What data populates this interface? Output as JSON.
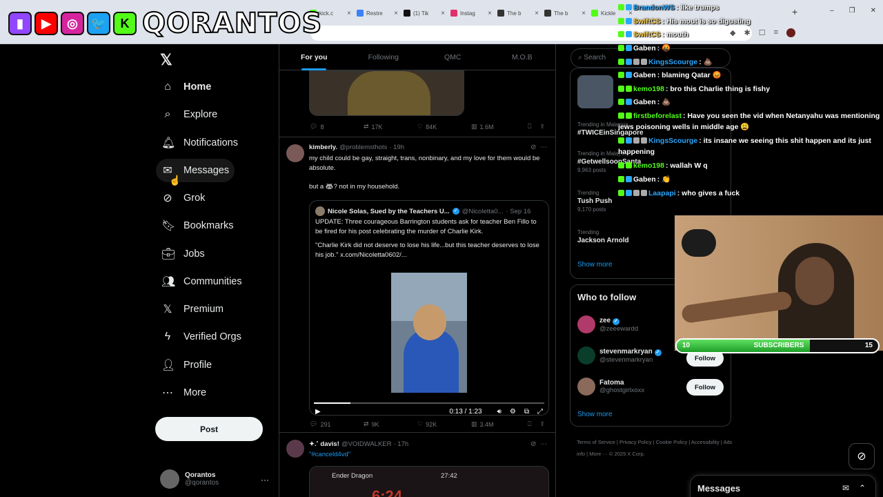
{
  "browser": {
    "tabs": [
      {
        "label": "kick.c",
        "color": "#53fc18"
      },
      {
        "label": "Restre",
        "color": "#3b82f6"
      },
      {
        "label": "(1) Tik",
        "color": "#111111"
      },
      {
        "label": "Instag",
        "color": "#e1306c"
      },
      {
        "label": "The b",
        "color": "#333333"
      },
      {
        "label": "The b",
        "color": "#333333"
      },
      {
        "label": "Kickle",
        "color": "#53fc18"
      }
    ],
    "newtab": "+",
    "window_controls": [
      "–",
      "❐",
      "✕"
    ]
  },
  "stream_logo": {
    "brand": "QORANTOS",
    "platforms": [
      {
        "name": "twitch-icon",
        "glyph": "▮",
        "color": "#9146ff"
      },
      {
        "name": "youtube-icon",
        "glyph": "▶",
        "color": "#ff0000"
      },
      {
        "name": "instagram-icon",
        "glyph": "◎",
        "color": "#d6249f"
      },
      {
        "name": "twitter-icon",
        "glyph": "🐦",
        "color": "#1da1f2"
      },
      {
        "name": "kick-icon",
        "glyph": "K",
        "color": "#53fc18"
      }
    ]
  },
  "nav": {
    "logo": "𝕏",
    "items": [
      {
        "name": "home",
        "label": "Home",
        "icon": "⌂"
      },
      {
        "name": "explore",
        "label": "Explore",
        "icon": "⌕"
      },
      {
        "name": "notifications",
        "label": "Notifications",
        "icon": "🔔︎"
      },
      {
        "name": "messages",
        "label": "Messages",
        "icon": "✉"
      },
      {
        "name": "grok",
        "label": "Grok",
        "icon": "⊘"
      },
      {
        "name": "bookmarks",
        "label": "Bookmarks",
        "icon": "🔖︎"
      },
      {
        "name": "jobs",
        "label": "Jobs",
        "icon": "💼︎"
      },
      {
        "name": "communities",
        "label": "Communities",
        "icon": "👥︎"
      },
      {
        "name": "premium",
        "label": "Premium",
        "icon": "𝕏"
      },
      {
        "name": "verified-orgs",
        "label": "Verified Orgs",
        "icon": "ϟ"
      },
      {
        "name": "profile",
        "label": "Profile",
        "icon": "👤︎"
      },
      {
        "name": "more",
        "label": "More",
        "icon": "⋯"
      }
    ],
    "post_label": "Post",
    "account": {
      "name": "Qorantos",
      "handle": "@qorantos",
      "more": "···"
    }
  },
  "feed": {
    "tabs": [
      "For you",
      "Following",
      "QMC",
      "M.O.B"
    ],
    "tweet1_actions": {
      "replies": "8",
      "reposts": "17K",
      "likes": "84K",
      "views": "1.6M"
    },
    "tweet2": {
      "name": "kimberly.",
      "handle": "@problemsthots",
      "time": "· 19h",
      "text1": "my child could be gay, straight, trans, nonbinary, and my love for them would be absolute.",
      "text2": "but a 🦝? not in my household.",
      "quote": {
        "name": "Nicole Solas, Sued by the Teachers U...",
        "handle": "@Nicoletta0...",
        "time": "· Sep 16",
        "text1": "UPDATE: Three courageous Barrington students ask for teacher Ben Fillo to be fired for his post celebrating the murder of Charlie Kirk.",
        "text2": "\"Charlie Kirk did not deserve to lose his life...but this teacher deserves to lose his job.\" x.com/Nicoletta0602/...",
        "video_time": "0:13 / 1:23",
        "video_progress": 0.16
      },
      "actions": {
        "replies": "291",
        "reposts": "9K",
        "likes": "92K",
        "views": "3.4M"
      }
    },
    "tweet3": {
      "name": "✦.˚ davis! ",
      "handle": "@VOIDWALKER",
      "time": "· 17h",
      "text": "\"#canceld4vd\"",
      "media_title": "Ender Dragon",
      "media_time": "27:42",
      "media_big": "6:24"
    }
  },
  "right": {
    "search_placeholder": "Search",
    "trends": [
      {
        "meta": "Trending in Malaysia",
        "title": "#TWICEinSingapore",
        "posts": ""
      },
      {
        "meta": "Trending in Malaysia",
        "title": "#GetwellsoonSanta",
        "posts": "9,963 posts"
      },
      {
        "meta": "Trending",
        "title": "Tush Push",
        "posts": "9,170 posts"
      },
      {
        "meta": "Trending",
        "title": "Jackson Arnold",
        "posts": ""
      }
    ],
    "show_more": "Show more",
    "who_to_follow": {
      "title": "Who to follow",
      "users": [
        {
          "name": "zee",
          "handle": "@zeeewardd",
          "color": "#b03a6a"
        },
        {
          "name": "stevenmarkryan",
          "handle": "@stevenmarkryan",
          "color": "#0a3d2a"
        },
        {
          "name": "Fatoma",
          "handle": "@ghostgirlxoxx",
          "color": "#8a6a5a"
        }
      ],
      "follow_label": "Follow",
      "show_more": "Show more"
    },
    "footer": "Terms of Service | Privacy Policy | Cookie Policy | Accessibility | Ads info | More ··· © 2025 X Corp."
  },
  "chat": [
    {
      "user": "BrandonWS",
      "color": "#2aa7ff",
      "msg": ": like trumps"
    },
    {
      "user": "SwiftCS",
      "color": "#ffd54f",
      "msg": ": His mout is so digusting"
    },
    {
      "user": "SwiftCS",
      "color": "#ffd54f",
      "msg": ": mouth"
    },
    {
      "user": "Gaben",
      "color": "#ffffff",
      "msg": ": 🤬"
    },
    {
      "user": "KingsScourge",
      "color": "#2aa7ff",
      "msg": ": 💩"
    },
    {
      "user": "Gaben",
      "color": "#ffffff",
      "msg": ": blaming Qatar 😡"
    },
    {
      "user": "kemo198",
      "color": "#53fc18",
      "msg": ": bro this Charlie thing is fishy"
    },
    {
      "user": "Gaben",
      "color": "#ffffff",
      "msg": ": 💩"
    },
    {
      "user": "firstbeforelast",
      "color": "#53fc18",
      "msg": ": Have you seen the vid when Netanyahu was mentioning jews poisoning wells in middle age 😩"
    },
    {
      "user": "KingsScourge",
      "color": "#2aa7ff",
      "msg": ": its insane we seeing this shit happen and its just happening"
    },
    {
      "user": "kemo198",
      "color": "#53fc18",
      "msg": ": wallah W q"
    },
    {
      "user": "Gaben",
      "color": "#ffffff",
      "msg": ": 👏"
    },
    {
      "user": "Laapapi",
      "color": "#2aa7ff",
      "msg": ": who gives a fuck"
    }
  ],
  "subs": {
    "current": "10",
    "label": "SUBSCRIBERS",
    "goal": "15",
    "progress": 0.66
  },
  "messages_drawer": {
    "title": "Messages"
  }
}
